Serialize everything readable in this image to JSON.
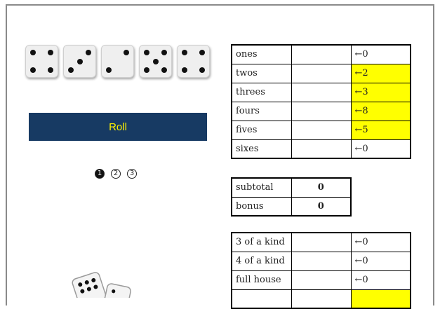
{
  "dice": [
    4,
    3,
    2,
    5,
    4
  ],
  "roll_button": {
    "label": "Roll"
  },
  "rolls": [
    {
      "label": "1",
      "used": true
    },
    {
      "label": "2",
      "used": false
    },
    {
      "label": "3",
      "used": false
    }
  ],
  "upper_section": [
    {
      "name": "ones",
      "score": "",
      "action": "←0",
      "highlighted": false
    },
    {
      "name": "twos",
      "score": "",
      "action": "←2",
      "highlighted": true
    },
    {
      "name": "threes",
      "score": "",
      "action": "←3",
      "highlighted": true
    },
    {
      "name": "fours",
      "score": "",
      "action": "←8",
      "highlighted": true
    },
    {
      "name": "fives",
      "score": "",
      "action": "←5",
      "highlighted": true
    },
    {
      "name": "sixes",
      "score": "",
      "action": "←0",
      "highlighted": false
    }
  ],
  "totals": [
    {
      "name": "subtotal",
      "value": "0"
    },
    {
      "name": "bonus",
      "value": "0"
    }
  ],
  "lower_section": [
    {
      "name": "3 of a kind",
      "score": "",
      "action": "←0",
      "highlighted": false
    },
    {
      "name": "4 of a kind",
      "score": "",
      "action": "←0",
      "highlighted": false
    },
    {
      "name": "full house",
      "score": "",
      "action": "←0",
      "highlighted": false
    },
    {
      "name": "",
      "score": "",
      "action": "",
      "highlighted": true
    }
  ],
  "colors": {
    "button_bg": "#173a63",
    "button_text": "#fff200",
    "highlight": "#ffff00"
  }
}
